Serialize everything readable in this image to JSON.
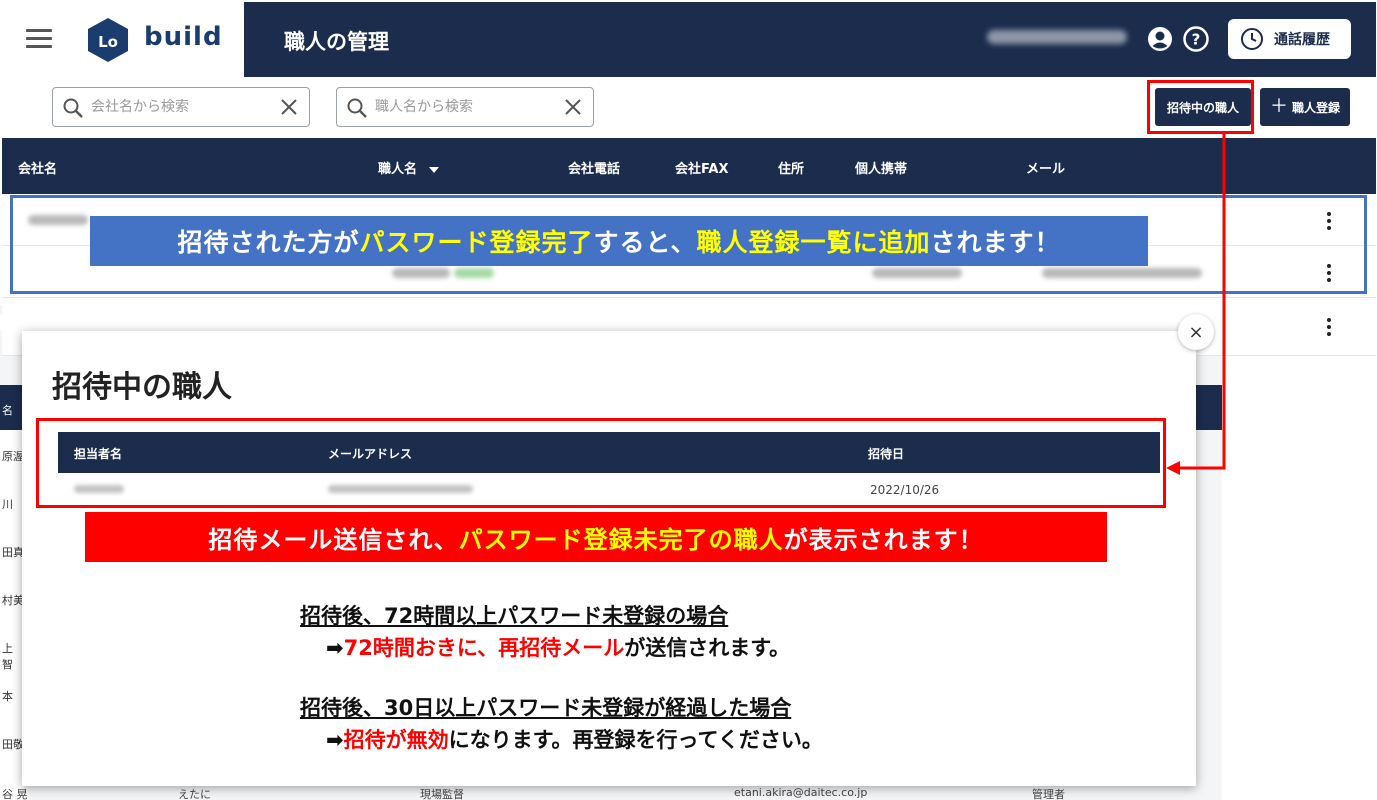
{
  "header": {
    "brand_text": "build",
    "title": "職人の管理",
    "history_label": "通話履歴"
  },
  "toolbar": {
    "company_search_placeholder": "会社名から検索",
    "worker_search_placeholder": "職人名から検索",
    "invited_button_label": "招待中の職人",
    "register_button_label": "職人登録"
  },
  "table": {
    "columns": [
      "会社名",
      "職人名",
      "会社電話",
      "会社FAX",
      "住所",
      "個人携帯",
      "メール"
    ]
  },
  "callouts": {
    "blue_banner": {
      "part1": "招待された方が",
      "part2": "パスワード登録完了",
      "part3": "すると、",
      "part4": "職人登録一覧に追加",
      "part5": "されます！"
    },
    "red_banner": {
      "part1": "招待メール送信され、",
      "part2": "パスワード登録未完了の職人",
      "part3": "が表示されます！"
    }
  },
  "modal": {
    "title": "招待中の職人",
    "close_symbol": "×",
    "columns": [
      "担当者名",
      "メールアドレス",
      "招待日"
    ],
    "rows": [
      {
        "date": "2022/10/26"
      }
    ]
  },
  "notes": {
    "note1_heading": "招待後、72時間以上パスワード未登録の場合",
    "note1_arrow": "➡",
    "note1_red": "72時間おきに、再招待メール",
    "note1_rest": "が送信されます。",
    "note2_heading": "招待後、30日以上パスワード未登録が経過した場合",
    "note2_arrow": "➡",
    "note2_red": "招待が無効",
    "note2_rest": "になります。再登録を行ってください。"
  },
  "background_screen": {
    "left_column": [
      "名",
      "原渥",
      "川",
      "田真",
      "村美",
      "上 智",
      "本",
      "田敬",
      "谷 晃"
    ],
    "bottom_row": {
      "kana": "えたに",
      "role": "現場監督",
      "email": "etani.akira@daitec.co.jp",
      "permission": "管理者"
    }
  },
  "icons": {
    "menu": "hamburger-icon",
    "user": "account-icon",
    "help": "help-icon",
    "history": "clock-icon",
    "search": "search-icon",
    "clear": "close-icon",
    "more": "kebab-icon"
  },
  "colors": {
    "navy": "#1b2c4d",
    "callout_blue": "#4472c4",
    "callout_red": "#ff0000",
    "highlight_yellow": "#ffff00"
  }
}
